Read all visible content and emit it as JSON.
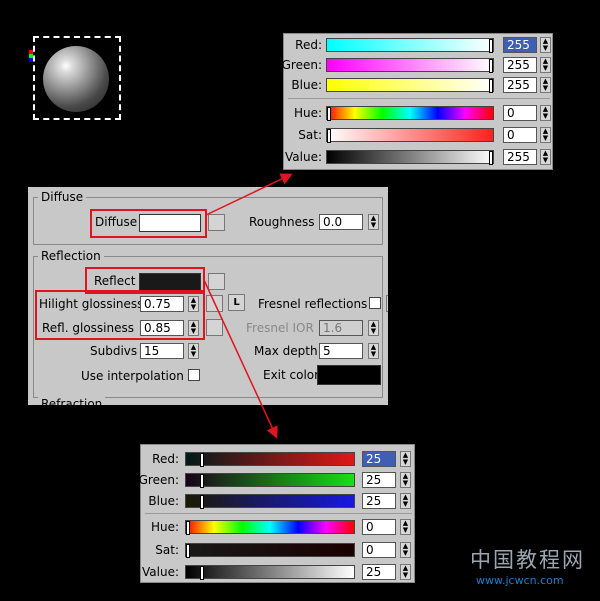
{
  "top_picker": {
    "rows": [
      {
        "label": "Red:",
        "value": "255",
        "selected": true
      },
      {
        "label": "Green:",
        "value": "255"
      },
      {
        "label": "Blue:",
        "value": "255"
      },
      {
        "label": "Hue:",
        "value": "0"
      },
      {
        "label": "Sat:",
        "value": "0"
      },
      {
        "label": "Value:",
        "value": "255"
      }
    ]
  },
  "bottom_picker": {
    "rows": [
      {
        "label": "Red:",
        "value": "25",
        "selected": true
      },
      {
        "label": "Green:",
        "value": "25"
      },
      {
        "label": "Blue:",
        "value": "25"
      },
      {
        "label": "Hue:",
        "value": "0"
      },
      {
        "label": "Sat:",
        "value": "0"
      },
      {
        "label": "Value:",
        "value": "25"
      }
    ]
  },
  "diffuse_group": {
    "title": "Diffuse",
    "diffuse_label": "Diffuse",
    "diffuse_color": "#ffffff",
    "roughness_label": "Roughness",
    "roughness_value": "0.0"
  },
  "reflection_group": {
    "title": "Reflection",
    "reflect_label": "Reflect",
    "reflect_color": "#191919",
    "hilight_label": "Hilight glossiness",
    "hilight_value": "0.75",
    "lock_label": "L",
    "refl_label": "Refl. glossiness",
    "refl_value": "0.85",
    "subdivs_label": "Subdivs",
    "subdivs_value": "15",
    "interp_label": "Use interpolation",
    "fresnel_label": "Fresnel reflections",
    "fresnel_lock": "L",
    "fresnel_ior_label": "Fresnel IOR",
    "fresnel_ior_value": "1.6",
    "maxdepth_label": "Max depth",
    "maxdepth_value": "5",
    "exit_label": "Exit color",
    "exit_color": "#000000"
  },
  "refraction_group": {
    "title": "Refraction"
  },
  "watermark": {
    "cn": "中国教程网",
    "url": "www.jcwcn.com"
  },
  "colors": {
    "highlight_red": "#e0141e",
    "panel_gray": "#c8c8c8"
  }
}
